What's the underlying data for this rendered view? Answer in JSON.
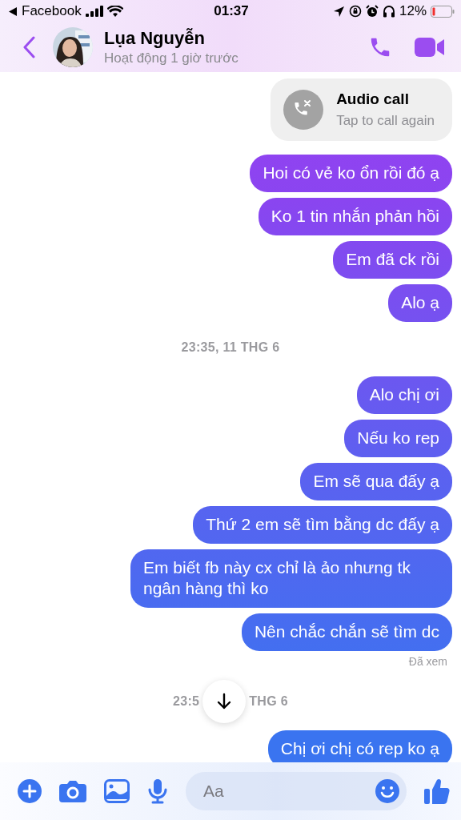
{
  "status_bar": {
    "back_app": "Facebook",
    "time": "01:37",
    "battery": "12%"
  },
  "header": {
    "name": "Lụa Nguyễn",
    "status": "Hoạt động 1 giờ trước"
  },
  "call_card": {
    "title": "Audio call",
    "subtitle": "Tap to call again"
  },
  "thread": [
    {
      "kind": "bubble",
      "text": "Hoi có vẻ ko ổn rồi đó ạ"
    },
    {
      "kind": "bubble",
      "text": "Ko 1 tin nhắn phản hồi"
    },
    {
      "kind": "bubble",
      "text": "Em đã ck rồi"
    },
    {
      "kind": "bubble",
      "text": "Alo ạ"
    },
    {
      "kind": "time",
      "segments": [
        "23:35, 11 THG 6"
      ]
    },
    {
      "kind": "bubble",
      "text": "Alo chị ơi"
    },
    {
      "kind": "bubble",
      "text": "Nếu ko rep"
    },
    {
      "kind": "bubble",
      "text": "Em sẽ qua đấy ạ"
    },
    {
      "kind": "bubble",
      "text": "Thứ 2 em sẽ tìm bằng dc đấy ạ"
    },
    {
      "kind": "bubble",
      "text": "Em biết fb này cx chỉ là ảo nhưng tk ngân hàng thì ko"
    },
    {
      "kind": "bubble",
      "text": "Nên chắc chắn sẽ tìm dc"
    },
    {
      "kind": "receipt",
      "text": "Đã xem"
    },
    {
      "kind": "time",
      "segments": [
        "23:5",
        "THG 6"
      ]
    },
    {
      "kind": "bubble",
      "text": "Chị ơi chị có rep ko ạ"
    }
  ],
  "composer": {
    "placeholder": "Aa"
  }
}
